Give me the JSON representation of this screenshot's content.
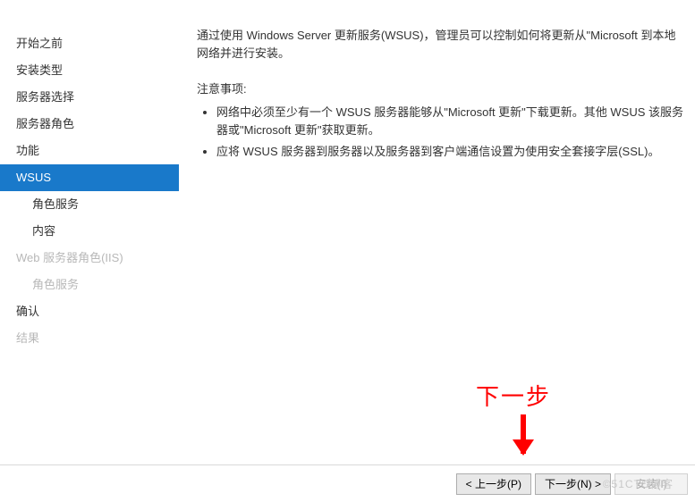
{
  "sidebar": {
    "items": [
      {
        "label": "开始之前",
        "sub": false,
        "selected": false,
        "disabled": false
      },
      {
        "label": "安装类型",
        "sub": false,
        "selected": false,
        "disabled": false
      },
      {
        "label": "服务器选择",
        "sub": false,
        "selected": false,
        "disabled": false
      },
      {
        "label": "服务器角色",
        "sub": false,
        "selected": false,
        "disabled": false
      },
      {
        "label": "功能",
        "sub": false,
        "selected": false,
        "disabled": false
      },
      {
        "label": "WSUS",
        "sub": false,
        "selected": true,
        "disabled": false
      },
      {
        "label": "角色服务",
        "sub": true,
        "selected": false,
        "disabled": false
      },
      {
        "label": "内容",
        "sub": true,
        "selected": false,
        "disabled": false
      },
      {
        "label": "Web 服务器角色(IIS)",
        "sub": false,
        "selected": false,
        "disabled": true
      },
      {
        "label": "角色服务",
        "sub": true,
        "selected": false,
        "disabled": true
      },
      {
        "label": "确认",
        "sub": false,
        "selected": false,
        "disabled": false
      },
      {
        "label": "结果",
        "sub": false,
        "selected": false,
        "disabled": true
      }
    ]
  },
  "content": {
    "para1": "通过使用 Windows Server 更新服务(WSUS)，管理员可以控制如何将更新从\"Microsoft 到本地网络并进行安装。",
    "note_heading": "注意事项:",
    "bullets": [
      "网络中必须至少有一个 WSUS 服务器能够从\"Microsoft 更新\"下载更新。其他 WSUS 该服务器或\"Microsoft 更新\"获取更新。",
      "应将 WSUS 服务器到服务器以及服务器到客户端通信设置为使用安全套接字层(SSL)。"
    ]
  },
  "buttons": {
    "prev": "< 上一步(P)",
    "next": "下一步(N) >",
    "install": "安装(I)"
  },
  "annotation": "下一步",
  "watermark": "©51CTO博客"
}
